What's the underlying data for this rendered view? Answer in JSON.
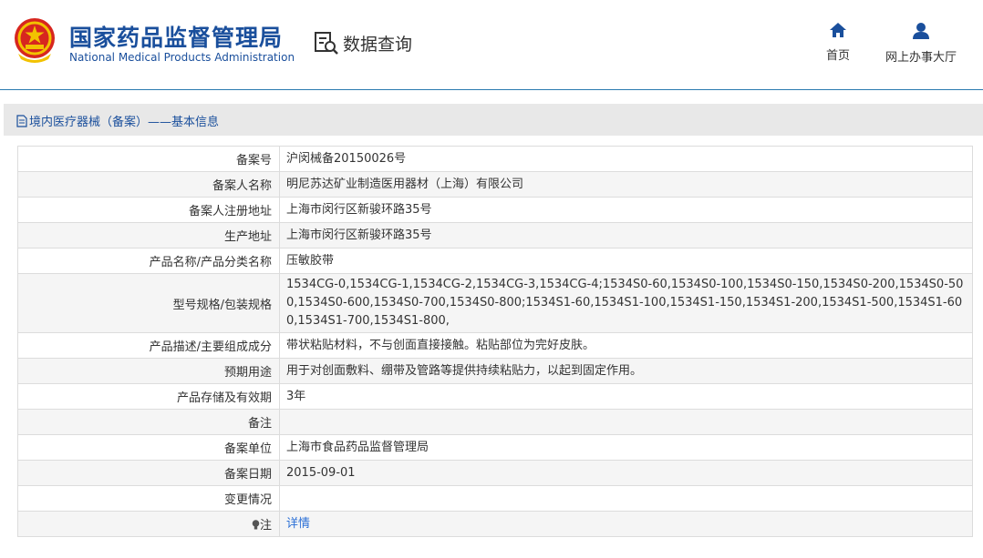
{
  "header": {
    "org_name_cn": "国家药品监督管理局",
    "org_name_en": "National Medical Products Administration",
    "query_label": "数据查询",
    "nav": {
      "home": "首页",
      "service_hall": "网上办事大厅"
    }
  },
  "breadcrumb": {
    "text": "境内医疗器械（备案）——基本信息"
  },
  "record": [
    {
      "label": "备案号",
      "value": "沪闵械备20150026号"
    },
    {
      "label": "备案人名称",
      "value": "明尼苏达矿业制造医用器材（上海）有限公司"
    },
    {
      "label": "备案人注册地址",
      "value": "上海市闵行区新骏环路35号"
    },
    {
      "label": "生产地址",
      "value": "上海市闵行区新骏环路35号"
    },
    {
      "label": "产品名称/产品分类名称",
      "value": "压敏胶带"
    },
    {
      "label": "型号规格/包装规格",
      "value": "1534CG-0,1534CG-1,1534CG-2,1534CG-3,1534CG-4;1534S0-60,1534S0-100,1534S0-150,1534S0-200,1534S0-500,1534S0-600,1534S0-700,1534S0-800;1534S1-60,1534S1-100,1534S1-150,1534S1-200,1534S1-500,1534S1-600,1534S1-700,1534S1-800,"
    },
    {
      "label": "产品描述/主要组成成分",
      "value": "带状粘贴材料，不与创面直接接触。粘贴部位为完好皮肤。"
    },
    {
      "label": "预期用途",
      "value": "用于对创面敷料、绷带及管路等提供持续粘贴力，以起到固定作用。"
    },
    {
      "label": "产品存储及有效期",
      "value": "3年"
    },
    {
      "label": "备注",
      "value": ""
    },
    {
      "label": "备案单位",
      "value": "上海市食品药品监督管理局"
    },
    {
      "label": "备案日期",
      "value": "2015-09-01"
    },
    {
      "label": "变更情况",
      "value": ""
    },
    {
      "label": "注",
      "value": "详情"
    }
  ],
  "colors": {
    "brand_blue": "#1a4f9c",
    "link_blue": "#2a6fd6",
    "emblem_red": "#d7261f",
    "emblem_gold": "#f2c200"
  },
  "icons": {
    "emblem": "national-emblem-icon",
    "query": "data-query-icon",
    "home": "home-icon",
    "user": "user-icon",
    "doc": "document-icon",
    "note": "lightbulb-icon"
  }
}
